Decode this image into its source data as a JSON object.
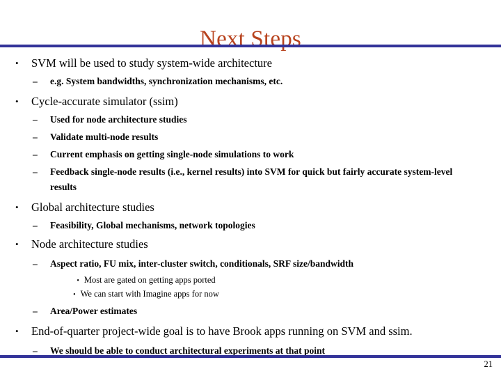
{
  "slide": {
    "title": "Next Steps",
    "page_number": "21",
    "accent_color": "#b8431e",
    "rule_color": "#333399",
    "text_color": "#000000",
    "markers": {
      "level1": "•",
      "level2": "–",
      "level3": "•"
    },
    "bullets": {
      "b1": "SVM will be used to study system-wide architecture",
      "b1s1": "e.g. System bandwidths, synchronization mechanisms, etc.",
      "b2": "Cycle-accurate simulator (ssim)",
      "b2s1": "Used for node architecture studies",
      "b2s2": "Validate multi-node results",
      "b2s3": "Current emphasis on getting single-node simulations to work",
      "b2s4": "Feedback single-node results (i.e., kernel results) into SVM for quick but fairly accurate system-level results",
      "b3": "Global architecture studies",
      "b3s1": "Feasibility, Global mechanisms, network topologies",
      "b4": "Node architecture studies",
      "b4s1": "Aspect ratio, FU mix, inter-cluster switch, conditionals, SRF size/bandwidth",
      "b4s1a": "Most are gated on getting apps ported",
      "b4s1b": "We can start with Imagine apps for now",
      "b4s2": "Area/Power estimates",
      "b5": "End-of-quarter project-wide goal is to have Brook apps running on SVM and ssim.",
      "b5s1": "We should be able to conduct architectural experiments at that point"
    }
  }
}
